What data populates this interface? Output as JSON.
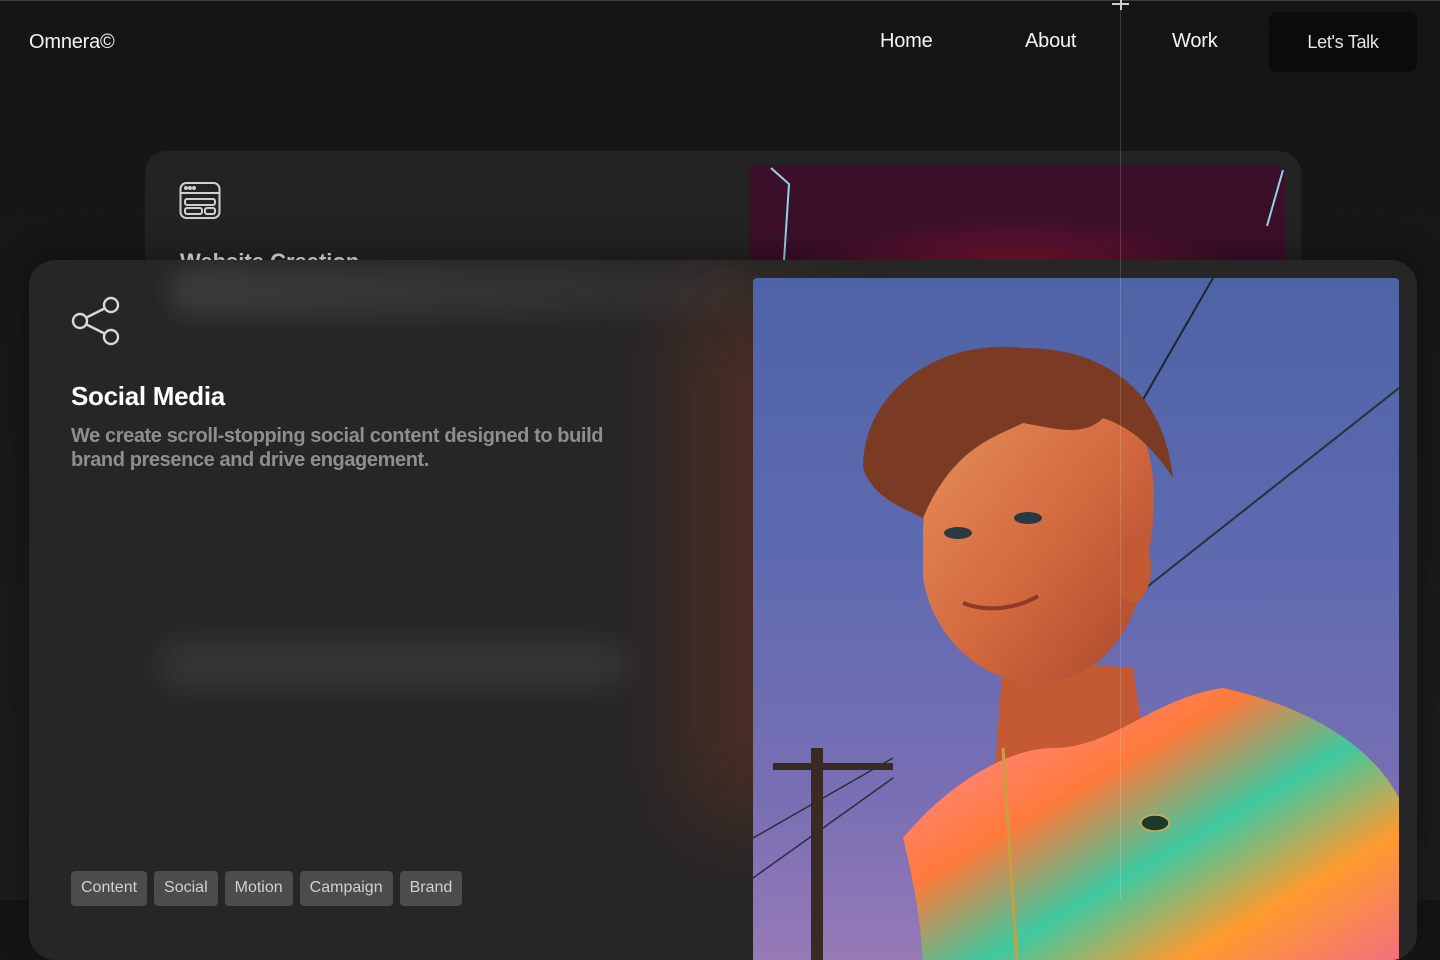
{
  "nav": {
    "logo": "Omnera©",
    "links": [
      "Home",
      "About",
      "Work"
    ],
    "cta": "Let's Talk"
  },
  "back_card": {
    "title": "Website Creation",
    "icon": "browser-window-icon"
  },
  "front_card": {
    "icon": "share-icon",
    "title": "Social Media",
    "description": "We create scroll-stopping social content designed to build brand presence and drive engagement.",
    "tags": [
      "Content",
      "Social",
      "Motion",
      "Campaign",
      "Brand"
    ]
  },
  "colors": {
    "background": "#1a1a1a",
    "card": "#262626",
    "tag_bg": "#4c4c4c",
    "cta_bg": "#0b0b0b"
  }
}
